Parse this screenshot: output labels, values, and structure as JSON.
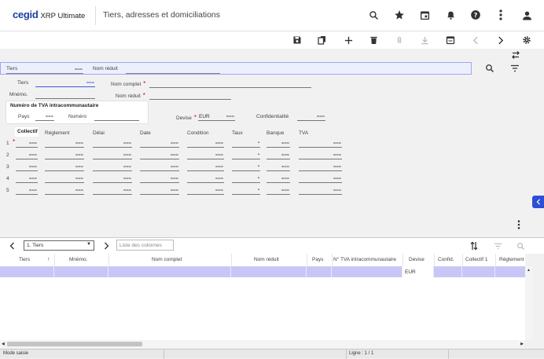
{
  "header": {
    "logo_brand": "cegid",
    "logo_product": "XRP Ultimate",
    "title": "Tiers, adresses et domiciliations"
  },
  "filter": {
    "tiers_label": "Tiers",
    "nom_reduit_label": "Nom réduit"
  },
  "form": {
    "tiers_label": "Tiers",
    "nom_complet_label": "Nom complet",
    "mnemo_label": "Mnémo.",
    "nom_reduit_label": "Nom réduit",
    "tva_section_title": "Numéro de TVA intracommunautaire",
    "pays_label": "Pays",
    "numero_label": "Numéro",
    "devise_label": "Devise",
    "devise_value": "EUR",
    "confidentialite_label": "Confidentialité",
    "table_headers": [
      "Collectif",
      "Règlement",
      "Délai",
      "Date",
      "Condition",
      "Taux",
      "Banque",
      "TVA"
    ],
    "row_numbers": [
      "1",
      "2",
      "3",
      "4",
      "5"
    ]
  },
  "grid": {
    "view_select": "1. Tiers",
    "columns_placeholder": "Liste des colonnes",
    "columns": [
      "Tiers",
      "Mnémo.",
      "Nom complet",
      "Nom réduit",
      "Pays",
      "N° TVA intracommunautaire",
      "Devise",
      "Confid.",
      "Collectif 1",
      "Règlement"
    ],
    "row_devise": "EUR"
  },
  "status": {
    "mode": "Mode saisie",
    "line": "Ligne : 1 / 1"
  },
  "colors": {
    "brand": "#1e3fa5",
    "accent": "#3b5bdb",
    "selection": "#c9c6f7"
  }
}
